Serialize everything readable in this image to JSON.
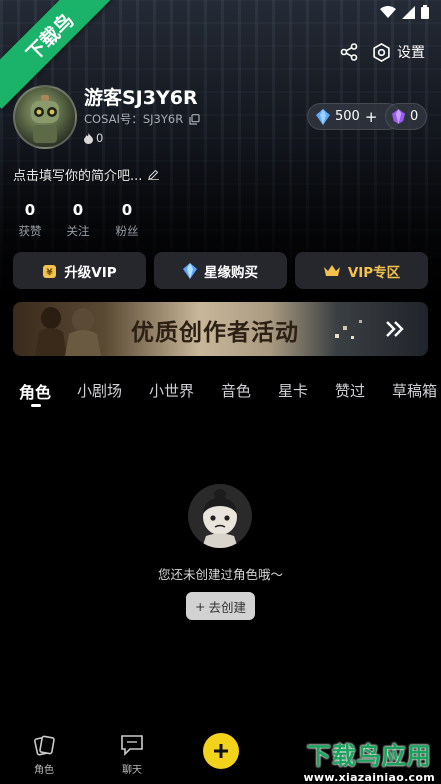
{
  "watermark_ribbon": "下载鸟",
  "header": {
    "share_icon": "share-icon",
    "settings_label": "设置"
  },
  "profile": {
    "username": "游客SJ3Y6R",
    "cosai_id": "COSAI号：SJ3Y6R",
    "fire_count": "0",
    "bio_placeholder": "点击填写你的简介吧..."
  },
  "currency": {
    "crystal": "500",
    "gem": "0"
  },
  "stats": [
    {
      "value": "0",
      "label": "获赞"
    },
    {
      "value": "0",
      "label": "关注"
    },
    {
      "value": "0",
      "label": "粉丝"
    }
  ],
  "actions": [
    {
      "label": "升级VIP",
      "icon": "vip-coin-icon",
      "color": "#f2f2f2"
    },
    {
      "label": "星缘购买",
      "icon": "diamond-icon",
      "color": "#f2f2f2"
    },
    {
      "label": "VIP专区",
      "icon": "crown-icon",
      "color": "#f2c14e"
    }
  ],
  "banner": {
    "title": "优质创作者活动"
  },
  "tabs": [
    "角色",
    "小剧场",
    "小世界",
    "音色",
    "星卡",
    "赞过",
    "草稿箱"
  ],
  "active_tab": "角色",
  "empty_state": {
    "message": "您还未创建过角色哦～",
    "button_label": "去创建"
  },
  "bottom_nav": [
    {
      "label": "角色",
      "icon": "character-cards-icon"
    },
    {
      "label": "聊天",
      "icon": "chat-icon"
    }
  ],
  "footer_watermark": {
    "title": "下载鸟应用",
    "url": "www.xiazainiao.com"
  },
  "colors": {
    "accent_yellow": "#f2d21b",
    "ribbon_green": "#1bb36a",
    "vip_gold": "#f2c14e"
  }
}
